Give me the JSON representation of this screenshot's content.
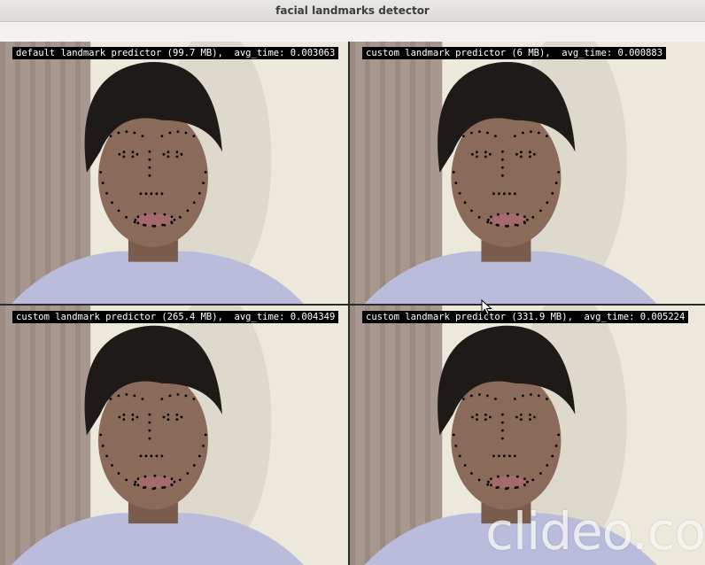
{
  "window": {
    "title": "facial landmarks detector"
  },
  "panes": [
    {
      "label": "default landmark predictor (99.7 MB),  avg_time: 0.003063"
    },
    {
      "label": "custom landmark predictor (6 MB),  avg_time: 0.000883"
    },
    {
      "label": "custom landmark predictor (265.4 MB),  avg_time: 0.004349"
    },
    {
      "label": "custom landmark predictor (331.9 MB),  avg_time: 0.005224"
    }
  ],
  "watermark": {
    "text": "clideo.co"
  },
  "colors": {
    "wall": "#ece8dc",
    "curtain": "#a8978f",
    "hair": "#1e1a18",
    "skin": "#8a6b5a",
    "shirt": "#b9bddb",
    "label_bg": "#000000",
    "label_fg": "#ffffff"
  }
}
